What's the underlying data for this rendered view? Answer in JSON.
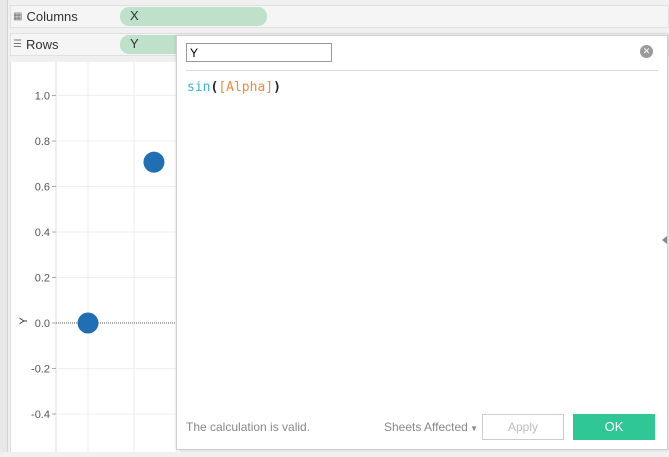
{
  "shelves": {
    "columns": {
      "label": "Columns",
      "pill": "X"
    },
    "rows": {
      "label": "Rows",
      "pill": "Y"
    }
  },
  "dialog": {
    "name": "Y",
    "formula": {
      "func": "sin",
      "open": "(",
      "field": "[Alpha]",
      "close": ")"
    },
    "status": "The calculation is valid.",
    "sheets_affected": "Sheets Affected",
    "apply": "Apply",
    "ok": "OK"
  },
  "chart_data": {
    "type": "scatter",
    "ylabel": "Y",
    "yticks": [
      "1.0",
      "0.8",
      "0.6",
      "0.4",
      "0.2",
      "0.0",
      "-0.2",
      "-0.4"
    ],
    "ylim": [
      -0.5,
      1.1
    ],
    "points": [
      {
        "x": 0,
        "y": 0
      },
      {
        "x": 0.785,
        "y": 0.707
      }
    ],
    "color": "#1f6fb2"
  }
}
